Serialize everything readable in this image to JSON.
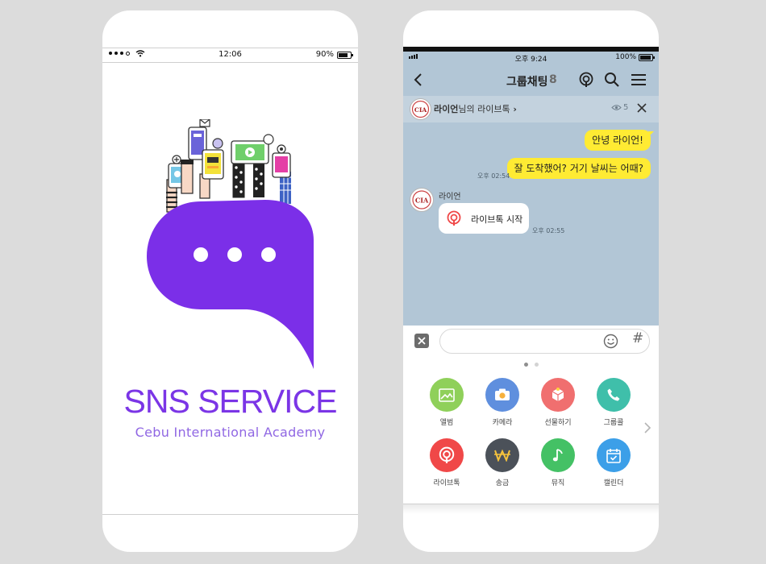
{
  "splash": {
    "status_bar": {
      "time": "12:06",
      "battery": "90%"
    },
    "title": "SNS SERVICE",
    "subtitle": "Cebu International Academy",
    "colors": {
      "brand": "#7b2fe8"
    }
  },
  "chat": {
    "status_bar": {
      "time": "오후 9:24",
      "battery": "100%"
    },
    "header": {
      "title": "그룹채팅",
      "member_count": "8",
      "icons": [
        "chevron-left-icon",
        "live-talk-icon",
        "search-icon",
        "hamburger-menu-icon"
      ]
    },
    "live_banner": {
      "user": "라이언",
      "suffix": "님의 라이브톡",
      "viewers": "5",
      "avatar_text": "CIA"
    },
    "messages": [
      {
        "type": "sent",
        "text": "안녕 라이언!"
      },
      {
        "type": "sent",
        "text": "잘 도착했어? 거기 날씨는 어때?",
        "time": "오후 02:54"
      },
      {
        "type": "received",
        "sender": "라이언",
        "text": "라이브톡 시작",
        "time": "오후 02:55"
      }
    ],
    "input": {
      "value": ""
    },
    "menu": [
      {
        "label": "앨범",
        "icon": "album-icon",
        "color": "#8fd05a"
      },
      {
        "label": "카메라",
        "icon": "camera-icon",
        "color": "#5f8fde"
      },
      {
        "label": "선물하기",
        "icon": "gift-icon",
        "color": "#f06f6f"
      },
      {
        "label": "그룹콜",
        "icon": "phone-icon",
        "color": "#3fbfaa"
      },
      {
        "label": "라이브톡",
        "icon": "live-talk-icon",
        "color": "#f04848"
      },
      {
        "label": "송금",
        "icon": "won-icon",
        "color": "#4b5159"
      },
      {
        "label": "뮤직",
        "icon": "music-icon",
        "color": "#44c165"
      },
      {
        "label": "캘린더",
        "icon": "calendar-icon",
        "color": "#3c9fe8"
      }
    ],
    "colors": {
      "chat_bg": "#b2c6d6",
      "bubble": "#ffeb33"
    }
  }
}
